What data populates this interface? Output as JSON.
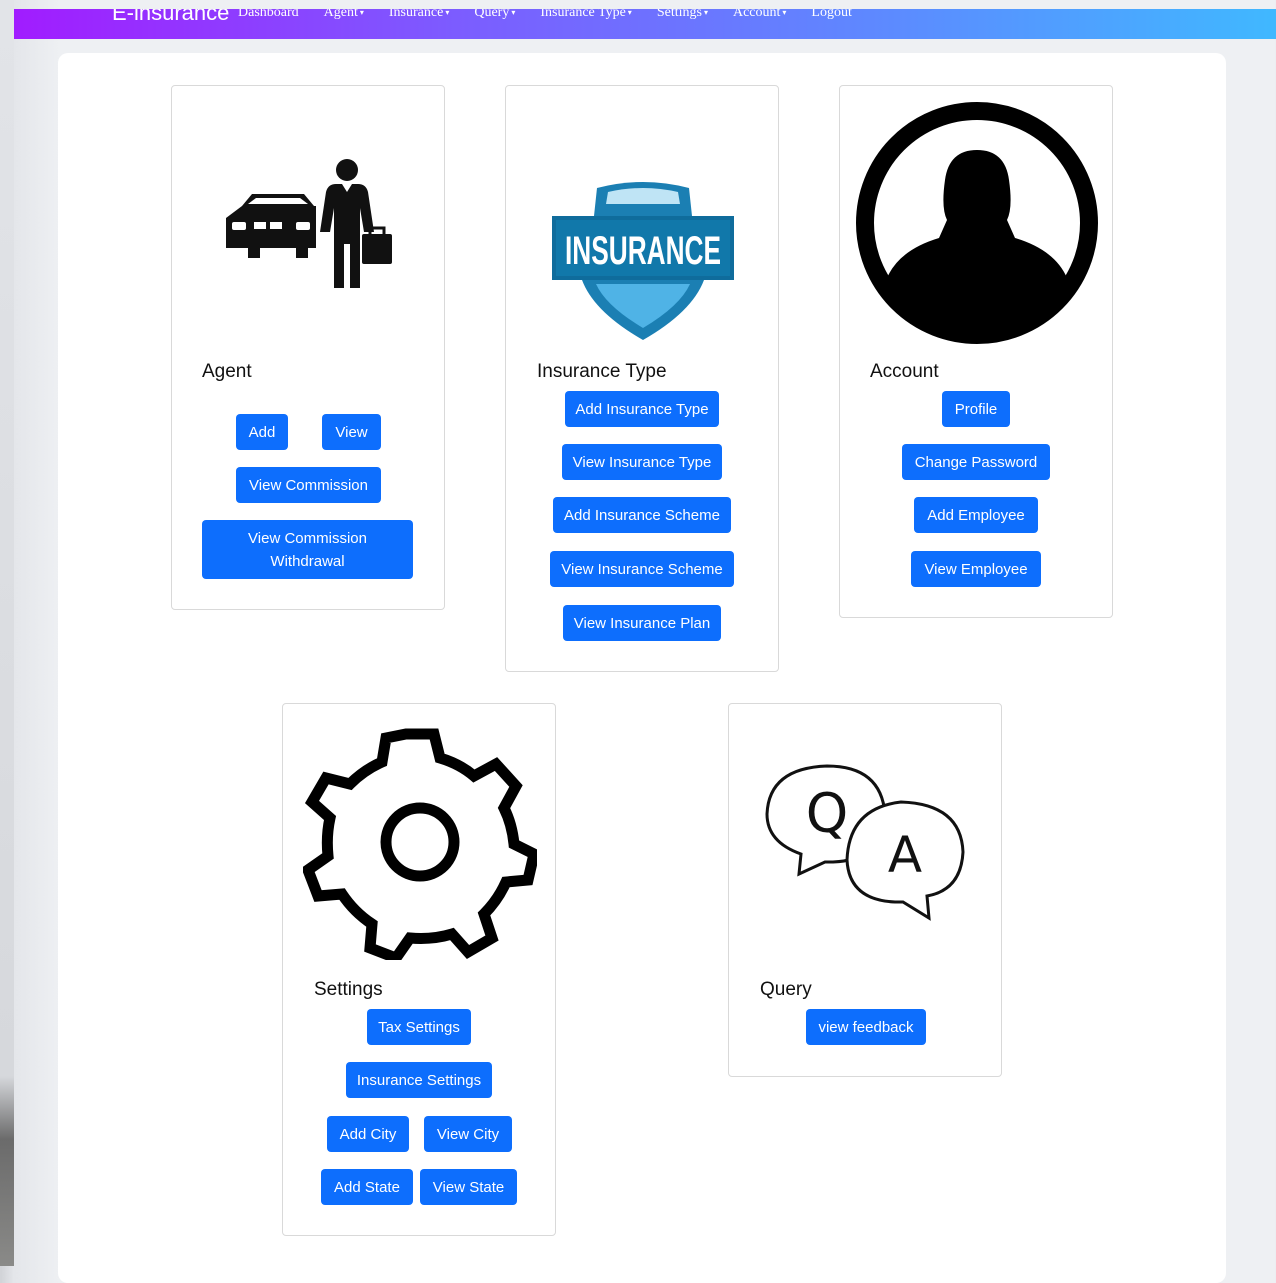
{
  "navbar": {
    "brand": "E-insurance",
    "links": [
      {
        "label": "Dashboard",
        "caret": ""
      },
      {
        "label": "Agent",
        "caret": "▾"
      },
      {
        "label": "Insurance",
        "caret": "▾"
      },
      {
        "label": "Query",
        "caret": "▾"
      },
      {
        "label": "Insurance Type",
        "caret": "▾"
      },
      {
        "label": "Settings",
        "caret": "▾"
      },
      {
        "label": "Account",
        "caret": "▾"
      },
      {
        "label": "Logout",
        "caret": ""
      }
    ]
  },
  "cards": {
    "agent": {
      "title": "Agent",
      "icon": "car-and-businessman-icon",
      "buttons": {
        "add": "Add",
        "view": "View",
        "view_commission": "View Commission",
        "view_commission_withdrawal_line1": "View Commission",
        "view_commission_withdrawal_line2": "Withdrawal"
      }
    },
    "insurance_type": {
      "title": "Insurance Type",
      "icon": "insurance-shield-icon",
      "logo_text": "INSURANCE",
      "buttons": {
        "add_type": "Add Insurance Type",
        "view_type": "View Insurance Type",
        "add_scheme": "Add Insurance Scheme",
        "view_scheme": "View Insurance Scheme",
        "view_plan": "View Insurance Plan"
      }
    },
    "account": {
      "title": "Account",
      "icon": "user-avatar-icon",
      "buttons": {
        "profile": "Profile",
        "change_password": "Change Password",
        "add_employee": "Add Employee",
        "view_employee": "View Employee"
      }
    },
    "settings": {
      "title": "Settings",
      "icon": "gear-icon",
      "buttons": {
        "tax": "Tax Settings",
        "insurance": "Insurance Settings",
        "add_city": "Add City",
        "view_city": "View City",
        "add_state": "Add State",
        "view_state": "View State"
      }
    },
    "query": {
      "title": "Query",
      "icon": "question-answer-bubbles-icon",
      "bubble_q": "Q",
      "bubble_a": "A",
      "buttons": {
        "view_feedback": "view feedback"
      }
    }
  },
  "colors": {
    "primary": "#0d6efd",
    "nav_start": "#a11cff",
    "nav_end": "#40b8ff",
    "shield": "#1b7fb3"
  }
}
